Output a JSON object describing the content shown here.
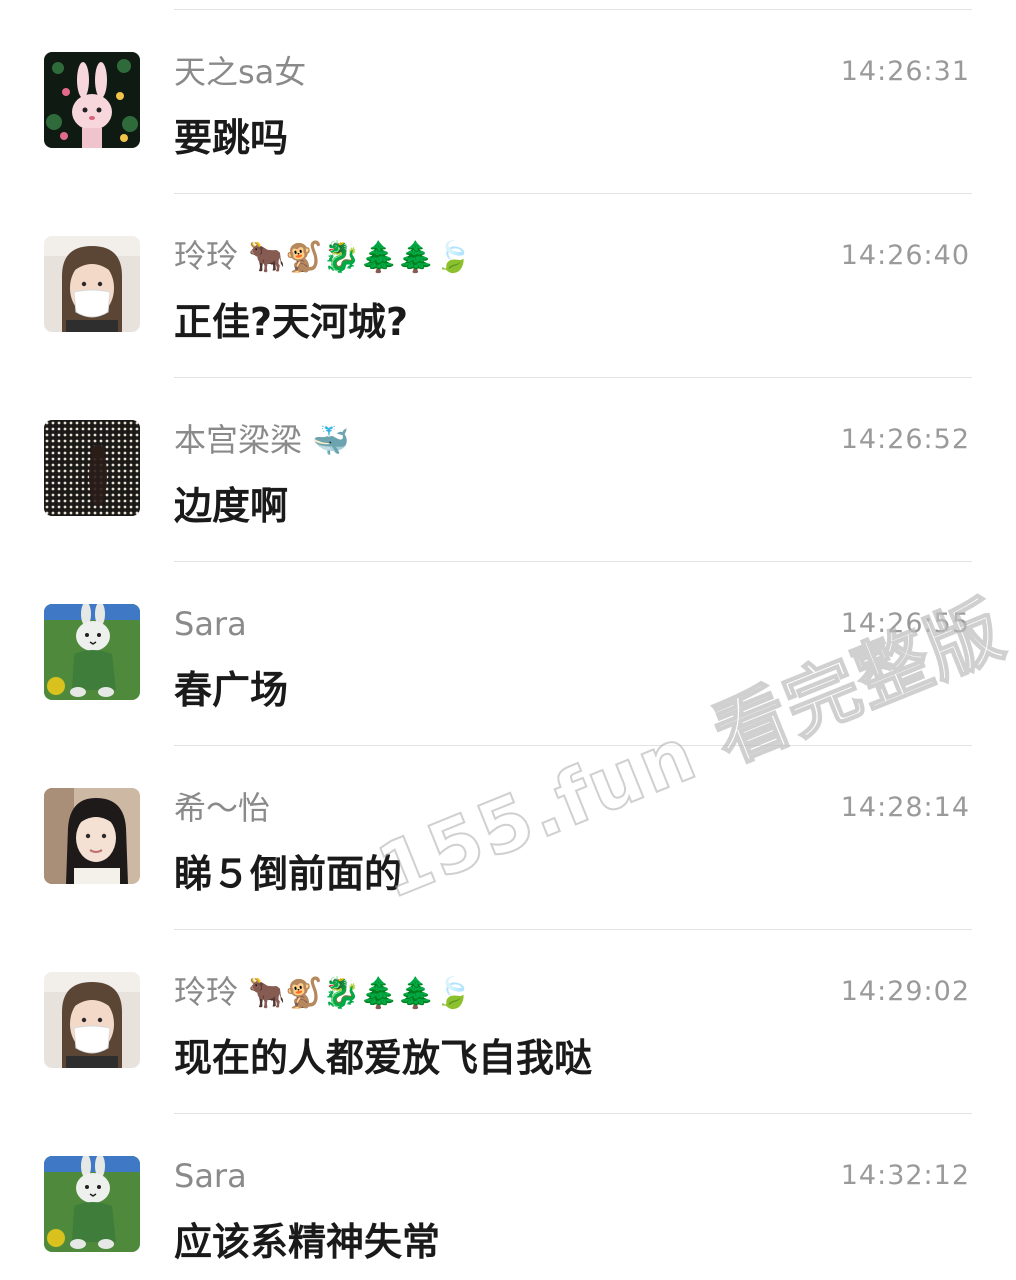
{
  "messages": [
    {
      "sender": "天之sa女",
      "emoji": "",
      "time": "14:26:31",
      "text": "要跳吗",
      "avatar_icon": "bunny-flowers-avatar"
    },
    {
      "sender": "玲玲",
      "emoji": "🐂🐒🐉🌲🌲🍃",
      "time": "14:26:40",
      "text": "正佳?天河城?",
      "avatar_icon": "woman-mask-avatar"
    },
    {
      "sender": "本宫梁梁",
      "emoji": "🐳",
      "time": "14:26:52",
      "text": "边度啊",
      "avatar_icon": "dark-lights-avatar"
    },
    {
      "sender": "Sara",
      "emoji": "",
      "time": "14:26:55",
      "text": "春广场",
      "avatar_icon": "miffy-avatar"
    },
    {
      "sender": "希～怡",
      "emoji": "",
      "time": "14:28:14",
      "text": "睇５倒前面的",
      "avatar_icon": "woman-selfie-avatar"
    },
    {
      "sender": "玲玲",
      "emoji": "🐂🐒🐉🌲🌲🍃",
      "time": "14:29:02",
      "text": "现在的人都爱放飞自我哒",
      "avatar_icon": "woman-mask-avatar"
    },
    {
      "sender": "Sara",
      "emoji": "",
      "time": "14:32:12",
      "text": "应该系精神失常",
      "avatar_icon": "miffy-avatar"
    }
  ],
  "watermark": "155.fun 看完整版",
  "colors": {
    "sender": "#8a8a8a",
    "time": "#9a9a9a",
    "text": "#1a1a1a",
    "divider": "#e2e2e2"
  }
}
